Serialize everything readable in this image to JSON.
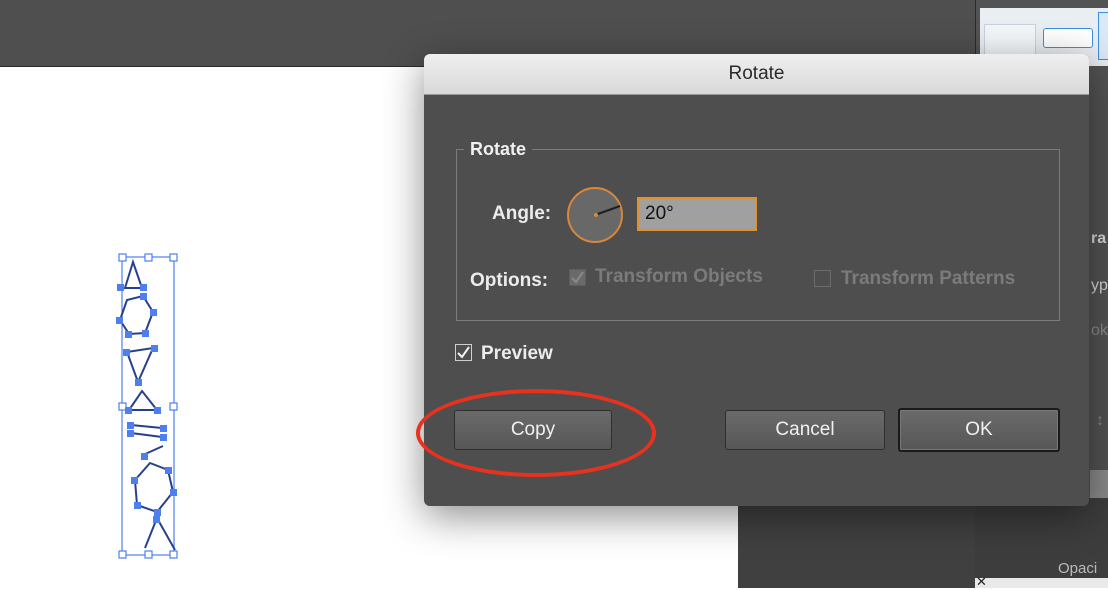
{
  "dialog": {
    "title": "Rotate",
    "group_label": "Rotate",
    "angle_label": "Angle:",
    "angle_value": "20°",
    "options_label": "Options:",
    "transform_objects_label": "Transform Objects",
    "transform_objects_checked": true,
    "transform_objects_enabled": false,
    "transform_patterns_label": "Transform Patterns",
    "transform_patterns_checked": false,
    "transform_patterns_enabled": false,
    "preview_label": "Preview",
    "preview_checked": true,
    "buttons": {
      "copy": "Copy",
      "cancel": "Cancel",
      "ok": "OK"
    }
  },
  "right_panel": {
    "fragments": [
      "ra",
      "yp",
      "ok",
      "Opaci"
    ]
  },
  "colors": {
    "selection": "#4d7ff0",
    "accent_orange": "#e38f2c",
    "annotation_red": "#e8321f",
    "dialog_bg": "#4e4e4e"
  }
}
